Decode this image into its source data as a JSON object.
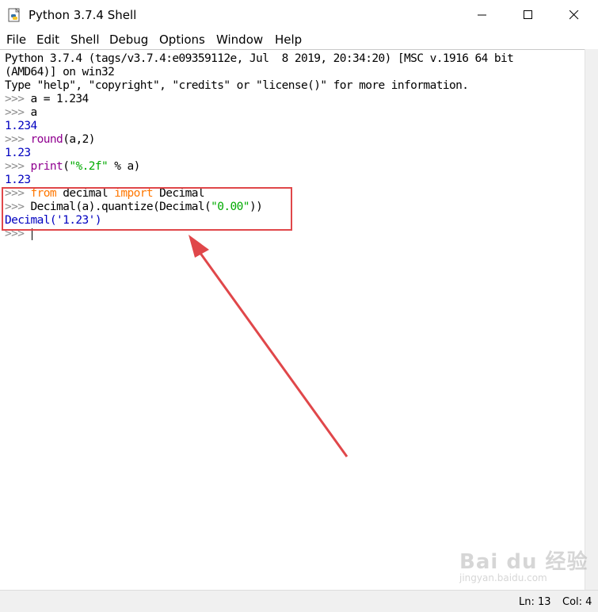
{
  "window": {
    "title": "Python 3.7.4 Shell",
    "controls": {
      "minimize": "minimize-icon",
      "maximize": "maximize-icon",
      "close": "close-icon"
    }
  },
  "menu": {
    "items": [
      {
        "label": "File"
      },
      {
        "label": "Edit"
      },
      {
        "label": "Shell"
      },
      {
        "label": "Debug"
      },
      {
        "label": "Options"
      },
      {
        "label": "Window"
      },
      {
        "label": "Help"
      }
    ]
  },
  "shell": {
    "banner1": "Python 3.7.4 (tags/v3.7.4:e09359112e, Jul  8 2019, 20:34:20) [MSC v.1916 64 bit",
    "banner2": "(AMD64)] on win32",
    "banner3": "Type \"help\", \"copyright\", \"credits\" or \"license()\" for more information.",
    "prompt": ">>>",
    "l4_code": " a = 1.234",
    "l5_code": " a",
    "l6_out": "1.234",
    "l7_fn": "round",
    "l7_rest": "(a,2)",
    "l8_out": "1.23",
    "l9_fn": "print",
    "l9_open": "(",
    "l9_str": "\"%.2f\"",
    "l9_rest": " % a)",
    "l10_out": "1.23",
    "l11_kw1": "from",
    "l11_mid": " decimal ",
    "l11_kw2": "import",
    "l11_end": " Decimal",
    "l12_pre": " Decimal(a).quantize(Decimal(",
    "l12_str": "\"0.00\"",
    "l12_end": "))",
    "l13_out": "Decimal('1.23')"
  },
  "status": {
    "line": "Ln: 13",
    "col": "Col: 4"
  },
  "watermark": {
    "main": "Bai du 经验",
    "sub": "jingyan.baidu.com"
  },
  "colors": {
    "keyword": "#ff7700",
    "builtin": "#900090",
    "string": "#00aa00",
    "output": "#0000c0",
    "annotation": "#e0474a"
  }
}
